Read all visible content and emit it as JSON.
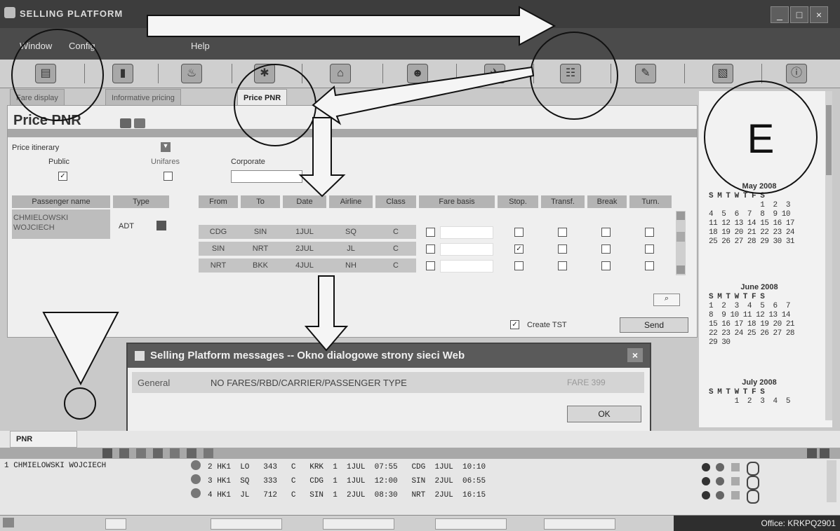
{
  "window": {
    "title": "SELLING PLATFORM",
    "btn_min": "_",
    "btn_max": "□",
    "btn_close": "×"
  },
  "menu": {
    "window": "Window",
    "config": "Config",
    "help": "Help"
  },
  "toolbar_icons": [
    "book-icon",
    "folder-icon",
    "seat-icon",
    "bug-icon",
    "car-icon",
    "person-icon",
    "plane-icon",
    "group-icon",
    "note-icon",
    "clipboard-icon",
    "info-icon"
  ],
  "tabs": {
    "fare_display": "Fare display",
    "informative_pricing": "Informative pricing",
    "price_pnr": "Price PNR"
  },
  "panel": {
    "title": "Price PNR",
    "price_select": "Price itinerary",
    "public_label": "Public",
    "unifares_label": "Unifares",
    "corporate_label": "Corporate",
    "passenger_headers": {
      "name": "Passenger name",
      "type": "Type"
    },
    "passenger": {
      "name_line1": "CHMIELOWSKI",
      "name_line2": "WOJCIECH",
      "type": "ADT"
    },
    "segment_headers": {
      "from": "From",
      "to": "To",
      "date": "Date",
      "airline": "Airline",
      "class": "Class",
      "fare_basis": "Fare basis",
      "stop": "Stop.",
      "transf": "Transf.",
      "break": "Break",
      "turn": "Turn."
    },
    "segments": [
      {
        "from": "CDG",
        "to": "SIN",
        "date": "1JUL",
        "airline": "SQ",
        "class": "C",
        "stop_checked": false
      },
      {
        "from": "SIN",
        "to": "NRT",
        "date": "2JUL",
        "airline": "JL",
        "class": "C",
        "stop_checked": true
      },
      {
        "from": "NRT",
        "to": "BKK",
        "date": "4JUL",
        "airline": "NH",
        "class": "C",
        "stop_checked": false
      }
    ],
    "create_tst": "Create TST",
    "send": "Send"
  },
  "calendar": {
    "months": [
      {
        "name": "May 2008",
        "rows": [
          "S M T W T F S",
          "            1  2  3",
          "4  5  6  7  8  9 10",
          "11 12 13 14 15 16 17",
          "18 19 20 21 22 23 24",
          "25 26 27 28 29 30 31"
        ]
      },
      {
        "name": "June 2008",
        "rows": [
          "S M T W T F S",
          "1  2  3  4  5  6  7",
          "8  9 10 11 12 13 14",
          "15 16 17 18 19 20 21",
          "22 23 24 25 26 27 28",
          "29 30"
        ]
      },
      {
        "name": "July 2008",
        "rows": [
          "S M T W T F S",
          "      1  2  3  4  5"
        ]
      }
    ]
  },
  "dialog": {
    "title": "Selling Platform messages -- Okno dialogowe strony sieci Web",
    "category": "General",
    "message": "NO FARES/RBD/CARRIER/PASSENGER TYPE",
    "code": "FARE 399",
    "ok": "OK"
  },
  "pnr": {
    "tab": "PNR",
    "passenger": "1 CHMIELOWSKI WOJCIECH",
    "segments": [
      "2 HK1  LO   343   C   KRK  1  1JUL  07:55   CDG  1JUL  10:10",
      "3 HK1  SQ   333   C   CDG  1  1JUL  12:00   SIN  2JUL  06:55",
      "4 HK1  JL   712   C   SIN  1  2JUL  08:30   NRT  2JUL  16:15"
    ]
  },
  "status": {
    "office": "Office: KRKPQ2901"
  },
  "annotation": {
    "letter": "E"
  }
}
